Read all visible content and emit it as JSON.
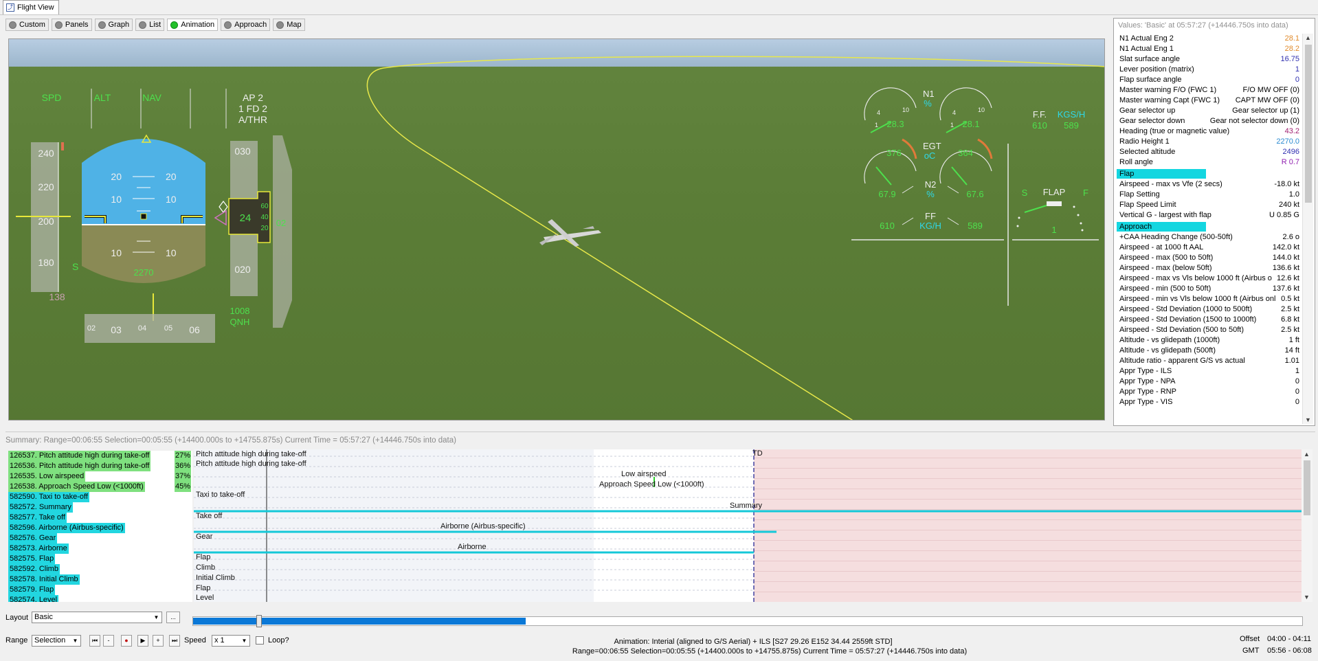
{
  "window": {
    "title": "Flight View"
  },
  "tabs": [
    {
      "label": "Custom",
      "active": false
    },
    {
      "label": "Panels",
      "active": false
    },
    {
      "label": "Graph",
      "active": false
    },
    {
      "label": "List",
      "active": false
    },
    {
      "label": "Animation",
      "active": true
    },
    {
      "label": "Approach",
      "active": false
    },
    {
      "label": "Map",
      "active": false
    }
  ],
  "pfd": {
    "fma": {
      "spd": "SPD",
      "alt": "ALT",
      "nav": "NAV",
      "ap": "AP 2",
      "fd": "1 FD 2",
      "athr": "A/THR"
    },
    "speed_ticks": [
      "240",
      "220",
      "200",
      "180"
    ],
    "speed_s": "S",
    "mach": "138",
    "pitch_labels": [
      "20",
      "20",
      "10",
      "10",
      "10",
      "10"
    ],
    "alt_ticks": [
      "030",
      "020"
    ],
    "alt_box": {
      "big": "24",
      "r1": "60",
      "r2": "40",
      "r3": "20"
    },
    "alt_bottom": "2270",
    "vs_label": "02",
    "heading_ticks": [
      "02",
      "03",
      "04",
      "05",
      "06"
    ],
    "qnh_value": "1008",
    "qnh_label": "QNH"
  },
  "engine": {
    "n1_label": "N1",
    "n1_unit": "%",
    "n1_left": "28.3",
    "n1_right": "28.1",
    "egt_label": "EGT",
    "egt_unit": "oC",
    "egt_left": "376",
    "egt_right": "364",
    "n2_label": "N2",
    "n2_unit": "%",
    "n2_left": "67.9",
    "n2_right": "67.6",
    "ff_label": "FF",
    "ff_unit": "KG/H",
    "ff_left": "610",
    "ff_right": "589",
    "ff2_label": "F.F.",
    "ff2_unit": "KGS/H",
    "ff2_left": "610",
    "ff2_right": "589",
    "gauge_10": "10",
    "gauge_4": "4",
    "gauge_1": "1"
  },
  "flap_display": {
    "s": "S",
    "label": "FLAP",
    "f": "F",
    "value": "1"
  },
  "values_panel": {
    "title": "Values: 'Basic' at 05:57:27 (+14446.750s into data)",
    "rows": [
      {
        "label": "N1 Actual Eng 2",
        "value": "28.1",
        "color": "#e08a2a"
      },
      {
        "label": "N1 Actual Eng 1",
        "value": "28.2",
        "color": "#e08a2a"
      },
      {
        "label": "Slat surface angle",
        "value": "16.75",
        "color": "#3030b0"
      },
      {
        "label": "Lever position (matrix)",
        "value": "1",
        "color": "#3030b0"
      },
      {
        "label": "Flap surface angle",
        "value": "0",
        "color": "#3030b0"
      },
      {
        "label": "Master warning F/O (FWC 1)",
        "value": "F/O MW OFF (0)",
        "color": "#000"
      },
      {
        "label": "Master warning Capt (FWC 1)",
        "value": "CAPT MW OFF (0)",
        "color": "#000"
      },
      {
        "label": "Gear selector up",
        "value": "Gear selector up (1)",
        "color": "#000"
      },
      {
        "label": "Gear selector down",
        "value": "Gear not selector down (0)",
        "color": "#000"
      },
      {
        "label": "Heading (true or magnetic value)",
        "value": "43.2",
        "color": "#a02070"
      },
      {
        "label": "Radio Height 1",
        "value": "2270.0",
        "color": "#2a8ad0"
      },
      {
        "label": "Selected altitude",
        "value": "2496",
        "color": "#3030b0"
      },
      {
        "label": "Roll angle",
        "value": "R 0.7",
        "color": "#9020b0"
      }
    ],
    "sections": [
      {
        "title": "Flap",
        "rows": [
          {
            "label": "Airspeed - max vs Vfe (2 secs)",
            "value": "-18.0 kt"
          },
          {
            "label": "Flap Setting",
            "value": "1.0"
          },
          {
            "label": "Flap Speed Limit",
            "value": "240 kt"
          },
          {
            "label": "Vertical G - largest with flap",
            "value": "U 0.85 G"
          }
        ]
      },
      {
        "title": "Approach",
        "rows": [
          {
            "label": "+CAA Heading Change (500-50ft)",
            "value": "2.6 o"
          },
          {
            "label": "Airspeed - at 1000 ft AAL",
            "value": "142.0 kt"
          },
          {
            "label": "Airspeed - max (500 to 50ft)",
            "value": "144.0 kt"
          },
          {
            "label": "Airspeed - max (below 50ft)",
            "value": "136.6 kt"
          },
          {
            "label": "Airspeed - max vs Vls below 1000 ft (Airbus o",
            "value": "12.6 kt"
          },
          {
            "label": "Airspeed - min (500 to 50ft)",
            "value": "137.6 kt"
          },
          {
            "label": "Airspeed - min vs Vls below 1000 ft (Airbus onl",
            "value": "0.5 kt"
          },
          {
            "label": "Airspeed - Std Deviation (1000 to 500ft)",
            "value": "2.5 kt"
          },
          {
            "label": "Airspeed - Std Deviation (1500 to 1000ft)",
            "value": "6.8 kt"
          },
          {
            "label": "Airspeed - Std Deviation (500 to 50ft)",
            "value": "2.5 kt"
          },
          {
            "label": "Altitude - vs glidepath (1000ft)",
            "value": "1 ft"
          },
          {
            "label": "Altitude - vs glidepath (500ft)",
            "value": "14 ft"
          },
          {
            "label": "Altitude ratio - apparent G/S vs actual",
            "value": "1.01"
          },
          {
            "label": "Appr Type - ILS",
            "value": "1"
          },
          {
            "label": "Appr Type - NPA",
            "value": "0"
          },
          {
            "label": "Appr Type - RNP",
            "value": "0"
          },
          {
            "label": "Appr Type - VIS",
            "value": "0"
          }
        ]
      }
    ]
  },
  "summary": {
    "title": "Summary:   Range=00:06:55    Selection=00:05:55 (+14400.000s to +14755.875s)    Current Time = 05:57:27 (+14446.750s into data)",
    "events": [
      {
        "label": "126537. Pitch attitude high during take-off",
        "pct": "27%",
        "green": true
      },
      {
        "label": "126536. Pitch attitude high during take-off",
        "pct": "36%",
        "green": true
      },
      {
        "label": "126535. Low airspeed",
        "pct": "37%",
        "green": true
      },
      {
        "label": "126538. Approach Speed Low (<1000ft)",
        "pct": "45%",
        "green": true
      },
      {
        "label": "582590. Taxi to take-off",
        "pct": "",
        "green": false
      },
      {
        "label": "582572. Summary",
        "pct": "",
        "green": false
      },
      {
        "label": "582577. Take off",
        "pct": "",
        "green": false
      },
      {
        "label": "582596. Airborne (Airbus-specific)",
        "pct": "",
        "green": false
      },
      {
        "label": "582576. Gear",
        "pct": "",
        "green": false
      },
      {
        "label": "582573. Airborne",
        "pct": "",
        "green": false
      },
      {
        "label": "582575. Flap",
        "pct": "",
        "green": false
      },
      {
        "label": "582592. Climb",
        "pct": "",
        "green": false
      },
      {
        "label": "582578. Initial Climb",
        "pct": "",
        "green": false
      },
      {
        "label": "582579. Flap",
        "pct": "",
        "green": false
      },
      {
        "label": "582574. Level",
        "pct": "",
        "green": false
      }
    ],
    "timeline_labels": {
      "td": "TD",
      "pitch1": "Pitch attitude high during take-off",
      "pitch2": "Pitch attitude high during take-off",
      "low_airspeed": "Low airspeed",
      "approach_low": "Approach Speed Low (<1000ft)",
      "taxi": "Taxi to take-off",
      "summary": "Summary",
      "takeoff": "Take off",
      "airborne_airbus": "Airborne (Airbus-specific)",
      "gear": "Gear",
      "airborne": "Airborne",
      "flap1": "Flap",
      "climb": "Climb",
      "initial_climb": "Initial Climb",
      "flap2": "Flap",
      "level": "Level"
    }
  },
  "controls": {
    "layout_label": "Layout",
    "layout_value": "Basic",
    "layout_btn": "...",
    "range_label": "Range",
    "range_value": "Selection",
    "speed_label": "Speed",
    "speed_value": "x 1",
    "loop_label": "Loop?",
    "loop_checked": false,
    "progress_fraction": 0.3,
    "status_line1": "Animation: Interial (aligned to G/S Aerial) + ILS [S27 29.26  E152 34.44  2559ft STD]",
    "status_line2": "Range=00:06:55    Selection=00:05:55 (+14400.000s to +14755.875s)    Current Time = 05:57:27 (+14446.750s into data)",
    "offset_label": "Offset",
    "offset_value": "04:00 - 04:11",
    "gmt_label": "GMT",
    "gmt_value": "05:56 - 06:08"
  }
}
